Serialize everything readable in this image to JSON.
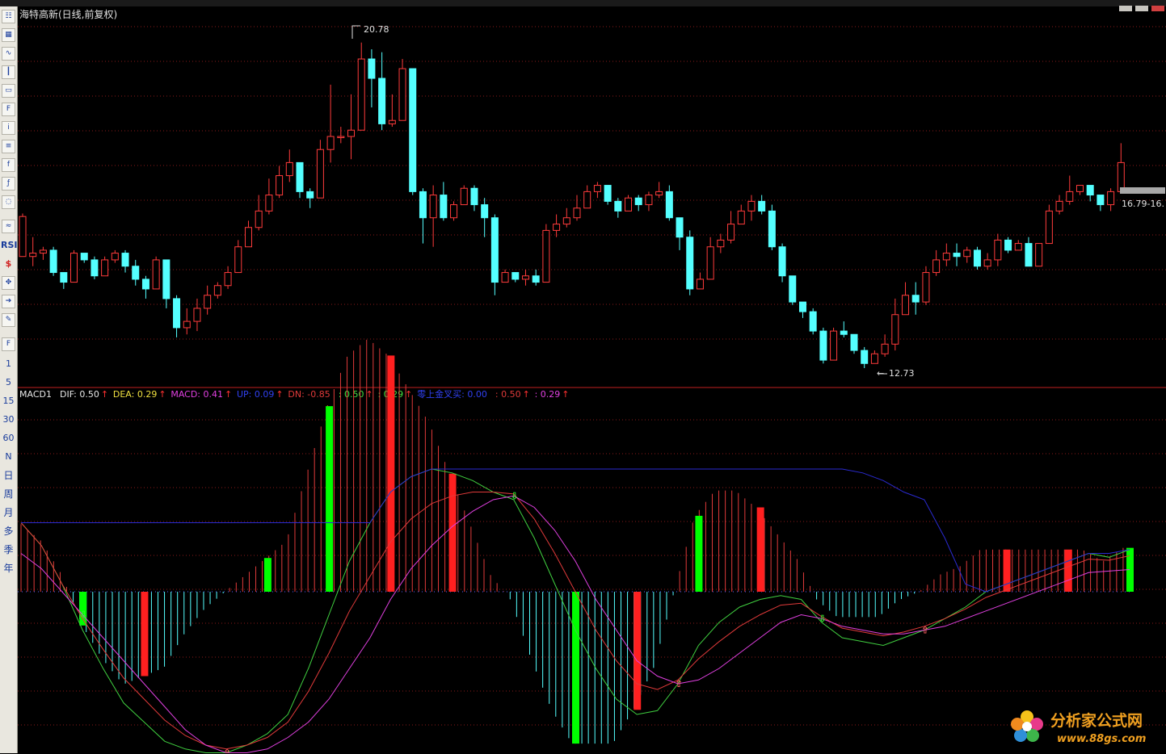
{
  "stock_title": "海特高新(日线,前复权)",
  "toolbar": {
    "labels": [
      "RSI",
      "$",
      "1",
      "5",
      "15",
      "30",
      "60",
      "N",
      "日",
      "周",
      "月",
      "多",
      "季",
      "年"
    ]
  },
  "indicator_legend": [
    {
      "text": "MACD1",
      "color": "#e8e8e8"
    },
    {
      "text": "DIF: 0.50",
      "color": "#e8e8e8",
      "arrow": "up"
    },
    {
      "text": "DEA: 0.29",
      "color": "#f0e040",
      "arrow": "up"
    },
    {
      "text": "MACD: 0.41",
      "color": "#e040e0",
      "arrow": "up"
    },
    {
      "text": "UP: 0.09",
      "color": "#3040f0",
      "arrow": "up"
    },
    {
      "text": "DN: -0.85",
      "color": "#e03a3a"
    },
    {
      "text": ": 0.50",
      "color": "#40e040",
      "arrow": "up"
    },
    {
      "text": ": 0.29",
      "color": "#40e040",
      "arrow": "up"
    },
    {
      "text": "零上金叉买: 0.00",
      "color": "#3040f0"
    },
    {
      "text": ": 0.50",
      "color": "#e03a3a",
      "arrow": "up"
    },
    {
      "text": ": 0.29",
      "color": "#e040e0",
      "arrow": "up"
    }
  ],
  "price_labels": {
    "high": "20.78",
    "low": "12.73",
    "current": "16.79-16."
  },
  "watermark": {
    "cn": "分析家公式网",
    "url": "www.88gs.com"
  },
  "colors": {
    "up": "#ff3b3b",
    "down": "#54ffff",
    "dif": "#e03a3a",
    "dea": "#e040e0",
    "up_line": "#2a2ad0",
    "green_line": "#40d040",
    "pos_bar": "#00ff00",
    "neg_bar": "#ff2020",
    "grid": "#8a1a1a"
  },
  "chart_data": {
    "type": "candlestick",
    "price_axis": {
      "min": 12.73,
      "max": 20.78
    },
    "candles": [
      [
        15.38,
        16.33,
        15.38,
        16.4
      ],
      [
        15.38,
        15.46,
        15.15,
        15.84
      ],
      [
        15.46,
        15.53,
        15.3,
        15.61
      ],
      [
        15.53,
        15.0,
        14.92,
        15.61
      ],
      [
        15.0,
        14.77,
        14.61,
        14.92
      ],
      [
        14.77,
        15.46,
        14.77,
        15.53
      ],
      [
        15.46,
        15.3,
        15.23,
        15.38
      ],
      [
        15.3,
        14.92,
        14.84,
        15.38
      ],
      [
        14.92,
        15.3,
        15.0,
        15.38
      ],
      [
        15.3,
        15.46,
        15.23,
        15.53
      ],
      [
        15.46,
        15.15,
        15.0,
        15.53
      ],
      [
        15.15,
        14.84,
        14.69,
        15.3
      ],
      [
        14.84,
        14.61,
        14.38,
        14.92
      ],
      [
        14.61,
        15.3,
        14.61,
        15.38
      ],
      [
        15.3,
        14.38,
        14.15,
        15.3
      ],
      [
        14.38,
        13.69,
        13.46,
        14.46
      ],
      [
        13.69,
        13.84,
        13.53,
        14.15
      ],
      [
        13.84,
        14.15,
        13.61,
        14.38
      ],
      [
        14.15,
        14.46,
        14.0,
        14.69
      ],
      [
        14.46,
        14.69,
        14.38,
        14.77
      ],
      [
        14.69,
        15.0,
        14.61,
        15.15
      ],
      [
        15.0,
        15.61,
        15.0,
        15.77
      ],
      [
        15.61,
        16.07,
        15.69,
        16.23
      ],
      [
        16.07,
        16.46,
        16.0,
        16.84
      ],
      [
        16.46,
        16.84,
        16.38,
        17.23
      ],
      [
        16.84,
        17.3,
        16.77,
        17.53
      ],
      [
        17.3,
        17.61,
        17.15,
        17.92
      ],
      [
        17.61,
        16.92,
        16.77,
        17.53
      ],
      [
        16.92,
        16.77,
        16.53,
        17.0
      ],
      [
        16.77,
        17.92,
        16.84,
        18.15
      ],
      [
        17.92,
        18.23,
        17.61,
        19.46
      ],
      [
        18.23,
        18.23,
        18.07,
        18.46
      ],
      [
        18.23,
        18.38,
        17.69,
        19.23
      ],
      [
        18.38,
        20.07,
        18.61,
        20.46
      ],
      [
        20.07,
        19.61,
        18.92,
        20.3
      ],
      [
        19.61,
        18.53,
        18.38,
        20.23
      ],
      [
        18.53,
        18.61,
        18.46,
        19.23
      ],
      [
        18.61,
        19.84,
        18.84,
        20.07
      ],
      [
        19.84,
        16.92,
        16.84,
        19.84
      ],
      [
        16.92,
        16.3,
        15.69,
        17.0
      ],
      [
        16.3,
        16.84,
        15.61,
        17.07
      ],
      [
        16.84,
        16.3,
        16.23,
        17.15
      ],
      [
        16.3,
        16.61,
        16.23,
        16.69
      ],
      [
        16.61,
        17.0,
        16.61,
        17.07
      ],
      [
        17.0,
        16.61,
        16.46,
        17.07
      ],
      [
        16.61,
        16.3,
        15.84,
        16.77
      ],
      [
        16.3,
        14.77,
        14.46,
        16.38
      ],
      [
        14.77,
        15.0,
        14.77,
        15.07
      ],
      [
        15.0,
        14.84,
        14.77,
        15.0
      ],
      [
        14.84,
        14.92,
        14.69,
        15.07
      ],
      [
        14.92,
        14.77,
        14.69,
        15.07
      ],
      [
        14.77,
        16.0,
        14.77,
        16.15
      ],
      [
        16.0,
        16.15,
        15.84,
        16.38
      ],
      [
        16.15,
        16.3,
        16.07,
        16.53
      ],
      [
        16.3,
        16.53,
        16.23,
        16.84
      ],
      [
        16.53,
        16.92,
        16.53,
        17.07
      ],
      [
        16.92,
        17.07,
        16.77,
        17.15
      ],
      [
        17.07,
        16.69,
        16.61,
        17.0
      ],
      [
        16.69,
        16.46,
        16.3,
        16.77
      ],
      [
        16.46,
        16.77,
        16.46,
        16.84
      ],
      [
        16.77,
        16.61,
        16.46,
        16.84
      ],
      [
        16.61,
        16.84,
        16.46,
        16.92
      ],
      [
        16.84,
        16.92,
        16.77,
        17.15
      ],
      [
        16.92,
        16.3,
        16.23,
        17.07
      ],
      [
        16.3,
        15.84,
        15.53,
        16.3
      ],
      [
        15.84,
        14.61,
        14.46,
        16.0
      ],
      [
        14.61,
        14.84,
        14.69,
        15.0
      ],
      [
        14.84,
        15.61,
        14.84,
        15.84
      ],
      [
        15.61,
        15.77,
        15.46,
        15.92
      ],
      [
        15.77,
        16.15,
        15.69,
        16.46
      ],
      [
        16.15,
        16.46,
        16.15,
        16.61
      ],
      [
        16.46,
        16.69,
        16.23,
        16.84
      ],
      [
        16.69,
        16.46,
        16.38,
        16.84
      ],
      [
        16.46,
        15.61,
        15.53,
        16.61
      ],
      [
        15.61,
        14.92,
        14.77,
        15.69
      ],
      [
        14.92,
        14.3,
        14.23,
        14.92
      ],
      [
        14.3,
        14.07,
        13.92,
        14.3
      ],
      [
        14.07,
        13.61,
        13.53,
        14.15
      ],
      [
        13.61,
        12.92,
        12.84,
        13.69
      ],
      [
        12.92,
        13.61,
        12.92,
        13.69
      ],
      [
        13.61,
        13.53,
        13.46,
        13.84
      ],
      [
        13.53,
        13.15,
        13.07,
        13.53
      ],
      [
        13.15,
        12.84,
        12.73,
        13.23
      ],
      [
        12.84,
        13.07,
        12.84,
        13.15
      ],
      [
        13.07,
        13.3,
        13.0,
        13.53
      ],
      [
        13.3,
        14.0,
        13.15,
        14.38
      ],
      [
        14.0,
        14.46,
        14.0,
        14.77
      ],
      [
        14.46,
        14.3,
        14.0,
        14.77
      ],
      [
        14.3,
        15.0,
        14.23,
        15.15
      ],
      [
        15.0,
        15.3,
        14.92,
        15.53
      ],
      [
        15.3,
        15.46,
        15.15,
        15.69
      ],
      [
        15.46,
        15.38,
        15.15,
        15.69
      ],
      [
        15.38,
        15.53,
        15.23,
        15.61
      ],
      [
        15.53,
        15.15,
        15.07,
        15.61
      ],
      [
        15.15,
        15.3,
        15.07,
        15.46
      ],
      [
        15.3,
        15.77,
        15.15,
        15.92
      ],
      [
        15.77,
        15.53,
        15.46,
        15.84
      ],
      [
        15.53,
        15.69,
        15.53,
        15.77
      ],
      [
        15.69,
        15.15,
        15.15,
        15.84
      ],
      [
        15.15,
        15.69,
        15.15,
        15.69
      ],
      [
        15.69,
        16.46,
        15.69,
        16.61
      ],
      [
        16.46,
        16.69,
        16.38,
        16.84
      ],
      [
        16.69,
        16.92,
        16.61,
        17.3
      ],
      [
        16.92,
        17.07,
        16.84,
        17.07
      ],
      [
        17.07,
        16.84,
        16.69,
        17.0
      ],
      [
        16.84,
        16.61,
        16.46,
        16.84
      ],
      [
        16.61,
        16.92,
        16.46,
        17.0
      ],
      [
        16.92,
        17.61,
        16.92,
        18.07
      ]
    ],
    "macd": {
      "dif": [
        0.9,
        0.6,
        0.1,
        -0.5,
        -1.0,
        -1.45,
        -1.7,
        -1.95,
        -2.05,
        -2.1,
        -2.1,
        -2.0,
        -1.85,
        -1.6,
        -1.0,
        -0.3,
        0.4,
        0.9,
        1.3,
        1.5,
        1.6,
        1.55,
        1.45,
        1.3,
        1.2,
        0.7,
        0.1,
        -0.5,
        -1.0,
        -1.4,
        -1.6,
        -1.55,
        -1.2,
        -0.7,
        -0.4,
        -0.2,
        -0.1,
        -0.05,
        -0.1,
        -0.4,
        -0.6,
        -0.65,
        -0.7,
        -0.6,
        -0.5,
        -0.35,
        -0.2,
        0.0,
        0.1,
        0.2,
        0.3,
        0.4,
        0.5,
        0.45,
        0.55
      ],
      "dea": [
        0.5,
        0.3,
        0.0,
        -0.3,
        -0.6,
        -0.9,
        -1.2,
        -1.5,
        -1.8,
        -2.0,
        -2.1,
        -2.1,
        -2.05,
        -1.9,
        -1.7,
        -1.4,
        -1.0,
        -0.6,
        -0.1,
        0.3,
        0.6,
        0.85,
        1.05,
        1.2,
        1.25,
        1.1,
        0.8,
        0.4,
        -0.1,
        -0.5,
        -0.9,
        -1.1,
        -1.2,
        -1.15,
        -1.0,
        -0.8,
        -0.6,
        -0.4,
        -0.3,
        -0.35,
        -0.45,
        -0.5,
        -0.55,
        -0.55,
        -0.5,
        -0.45,
        -0.35,
        -0.25,
        -0.15,
        -0.05,
        0.05,
        0.15,
        0.25,
        0.27,
        0.29
      ],
      "up": 0.09,
      "dn": -0.85
    },
    "xlabel": "",
    "ylabel": ""
  }
}
